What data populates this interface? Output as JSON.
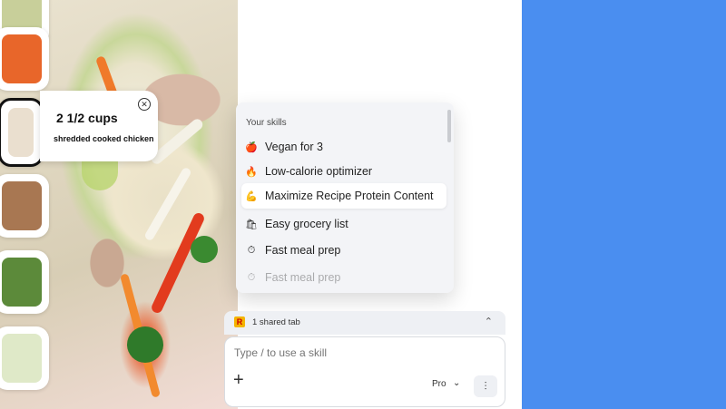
{
  "ingredient_card": {
    "quantity": "2 1/2 cups",
    "description": "shredded cooked chicken",
    "close_icon": "close-circle-icon"
  },
  "skills_menu": {
    "header": "Your skills",
    "items": [
      {
        "icon": "🍎",
        "label": "Vegan for 3"
      },
      {
        "icon": "🔥",
        "label": "Low-calorie optimizer"
      },
      {
        "icon": "💪",
        "label": "Maximize Recipe Protein Content"
      },
      {
        "icon": "🛍",
        "label": "Easy grocery list"
      },
      {
        "icon": "⏱",
        "label": "Fast meal prep"
      },
      {
        "icon": "⏱",
        "label": "Fast meal prep"
      }
    ]
  },
  "shared_tab": {
    "badge": "R",
    "label": "1 shared tab",
    "chevron_icon": "chevron-up-icon"
  },
  "composer": {
    "placeholder": "Type / to use a skill",
    "add_icon": "plus-icon",
    "model": "Pro",
    "send_icon": "audio-wave-icon"
  },
  "colors": {
    "background": "#4a8ef0",
    "panel": "#ffffff",
    "menu": "#f3f4f7"
  }
}
